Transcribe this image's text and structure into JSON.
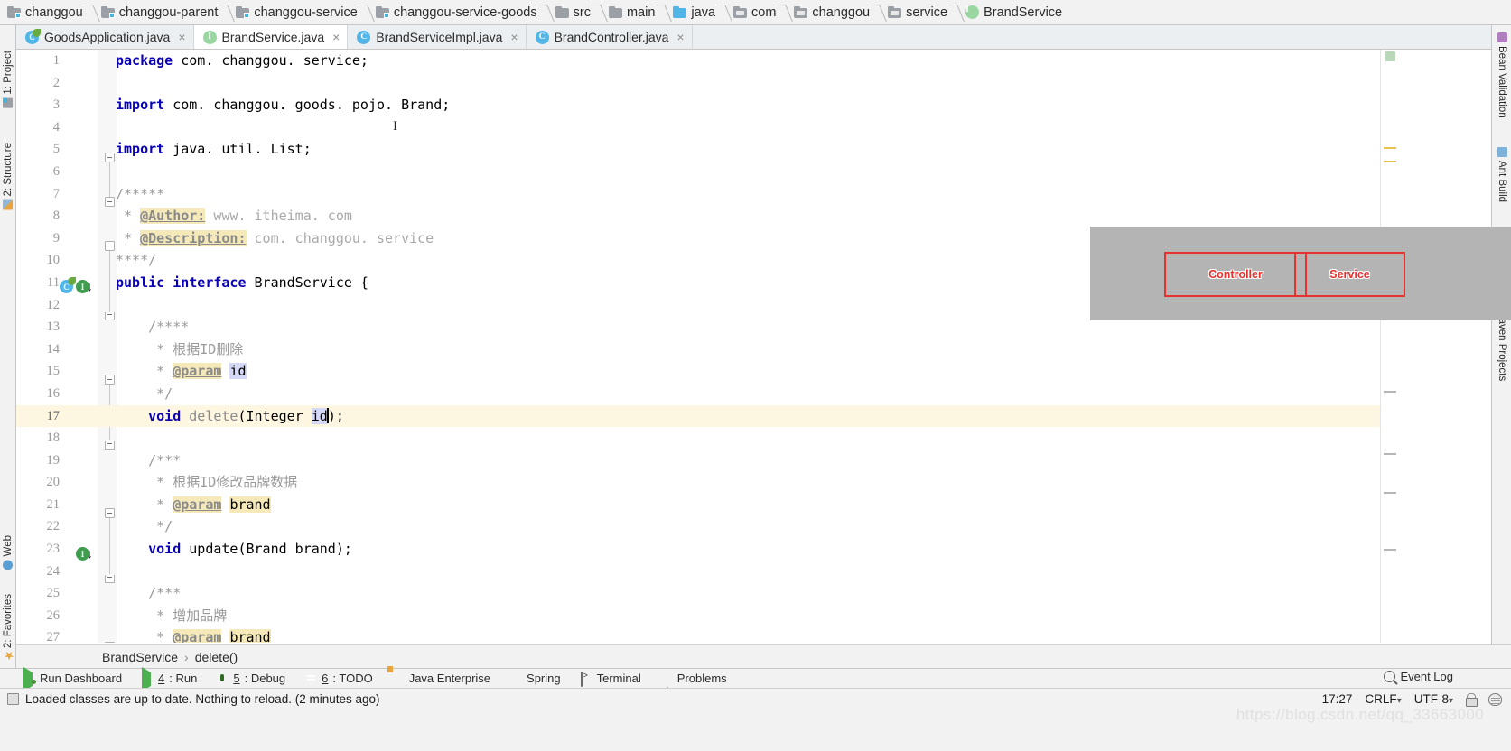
{
  "breadcrumb": {
    "items": [
      {
        "label": "changgou",
        "icon": "module-icon"
      },
      {
        "label": "changgou-parent",
        "icon": "module-icon"
      },
      {
        "label": "changgou-service",
        "icon": "module-icon"
      },
      {
        "label": "changgou-service-goods",
        "icon": "module-icon"
      },
      {
        "label": "src",
        "icon": "folder-icon"
      },
      {
        "label": "main",
        "icon": "folder-icon"
      },
      {
        "label": "java",
        "icon": "source-folder-icon"
      },
      {
        "label": "com",
        "icon": "package-icon"
      },
      {
        "label": "changgou",
        "icon": "package-icon"
      },
      {
        "label": "service",
        "icon": "package-icon"
      },
      {
        "label": "BrandService",
        "icon": "interface-icon"
      }
    ]
  },
  "tabs": [
    {
      "label": "GoodsApplication.java",
      "icon": "spring-boot-class-icon",
      "active": false,
      "close": "×"
    },
    {
      "label": "BrandService.java",
      "icon": "interface-icon",
      "active": true,
      "close": "×"
    },
    {
      "label": "BrandServiceImpl.java",
      "icon": "class-icon",
      "active": false,
      "close": "×"
    },
    {
      "label": "BrandController.java",
      "icon": "class-icon",
      "active": false,
      "close": "×"
    }
  ],
  "left_toolwindows": [
    {
      "label": "1: Project",
      "icon": "project-icon"
    },
    {
      "label": "2: Structure",
      "icon": "structure-icon"
    },
    {
      "label": "Web",
      "icon": "web-icon"
    },
    {
      "label": "2: Favorites",
      "icon": "favorites-star-icon"
    }
  ],
  "right_toolwindows": [
    {
      "label": "Bean Validation",
      "icon": "bean-validation-icon"
    },
    {
      "label": "Ant Build",
      "icon": "ant-build-icon"
    },
    {
      "label": "Maven Projects",
      "icon": "maven-icon"
    }
  ],
  "editor": {
    "language": "java",
    "caret_line": 17,
    "lines": [
      {
        "n": "1",
        "segments": [
          {
            "t": "package",
            "c": "kw"
          },
          {
            "t": " com. changgou. service;",
            "c": "plain"
          }
        ]
      },
      {
        "n": "2",
        "segments": []
      },
      {
        "n": "3",
        "segments": [
          {
            "t": "import",
            "c": "kw"
          },
          {
            "t": " com. changgou. goods. pojo. Brand;",
            "c": "plain"
          }
        ]
      },
      {
        "n": "4",
        "segments": []
      },
      {
        "n": "5",
        "segments": [
          {
            "t": "import",
            "c": "kw"
          },
          {
            "t": " java. util. List;",
            "c": "plain"
          }
        ]
      },
      {
        "n": "6",
        "segments": []
      },
      {
        "n": "7",
        "segments": [
          {
            "t": "/*****",
            "c": "cm"
          }
        ]
      },
      {
        "n": "8",
        "segments": [
          {
            "t": " * ",
            "c": "cm"
          },
          {
            "t": "@Author:",
            "c": "tag"
          },
          {
            "t": " www. itheima. com",
            "c": "tagv"
          }
        ]
      },
      {
        "n": "9",
        "segments": [
          {
            "t": " * ",
            "c": "cm"
          },
          {
            "t": "@Description:",
            "c": "tag"
          },
          {
            "t": " com. changgou. service",
            "c": "tagv"
          }
        ]
      },
      {
        "n": "10",
        "segments": [
          {
            "t": "****/",
            "c": "cm"
          }
        ]
      },
      {
        "n": "11",
        "segments": [
          {
            "t": "public interface",
            "c": "kw"
          },
          {
            "t": " BrandService {",
            "c": "plain"
          }
        ]
      },
      {
        "n": "12",
        "segments": []
      },
      {
        "n": "13",
        "segments": [
          {
            "t": "    /****",
            "c": "cm"
          }
        ]
      },
      {
        "n": "14",
        "segments": [
          {
            "t": "     * 根据ID删除",
            "c": "cm"
          }
        ]
      },
      {
        "n": "15",
        "segments": [
          {
            "t": "     * ",
            "c": "cm"
          },
          {
            "t": "@param",
            "c": "tag"
          },
          {
            "t": " ",
            "c": "cm"
          },
          {
            "t": "id",
            "c": "sel"
          }
        ]
      },
      {
        "n": "16",
        "segments": [
          {
            "t": "     */",
            "c": "cm"
          }
        ]
      },
      {
        "n": "17",
        "segments": [
          {
            "t": "    void",
            "c": "kw"
          },
          {
            "t": " ",
            "c": "plain"
          },
          {
            "t": "delete",
            "c": "mname"
          },
          {
            "t": "(Integer ",
            "c": "plain"
          },
          {
            "t": "id",
            "c": "sel"
          },
          {
            "t": ");",
            "c": "plain"
          }
        ]
      },
      {
        "n": "18",
        "segments": []
      },
      {
        "n": "19",
        "segments": [
          {
            "t": "    /***",
            "c": "cm"
          }
        ]
      },
      {
        "n": "20",
        "segments": [
          {
            "t": "     * 根据ID修改品牌数据",
            "c": "cm"
          }
        ]
      },
      {
        "n": "21",
        "segments": [
          {
            "t": "     * ",
            "c": "cm"
          },
          {
            "t": "@param",
            "c": "tag"
          },
          {
            "t": " ",
            "c": "cm"
          },
          {
            "t": "brand",
            "c": "hl"
          }
        ]
      },
      {
        "n": "22",
        "segments": [
          {
            "t": "     */",
            "c": "cm"
          }
        ]
      },
      {
        "n": "23",
        "segments": [
          {
            "t": "    void",
            "c": "kw"
          },
          {
            "t": " update(Brand brand);",
            "c": "plain"
          }
        ]
      },
      {
        "n": "24",
        "segments": []
      },
      {
        "n": "25",
        "segments": [
          {
            "t": "    /***",
            "c": "cm"
          }
        ]
      },
      {
        "n": "26",
        "segments": [
          {
            "t": "     * 增加品牌",
            "c": "cm"
          }
        ]
      },
      {
        "n": "27",
        "segments": [
          {
            "t": "     * ",
            "c": "cm"
          },
          {
            "t": "@param",
            "c": "tag"
          },
          {
            "t": " ",
            "c": "cm"
          },
          {
            "t": "brand",
            "c": "hl"
          }
        ]
      }
    ]
  },
  "overlay": {
    "boxes": [
      {
        "label": "Controller"
      },
      {
        "label": "Service"
      }
    ],
    "border_color": "#e8302d",
    "background_color": "#b4b4b4"
  },
  "structure_bar": {
    "class": "BrandService",
    "separator": "›",
    "member": "delete()"
  },
  "bottom_toolwindows": [
    {
      "label": "Run Dashboard",
      "mnemonic": "",
      "icon": "run-dashboard-icon"
    },
    {
      "label": ": Run",
      "mnemonic": "4",
      "icon": "run-icon"
    },
    {
      "label": ": Debug",
      "mnemonic": "5",
      "icon": "debug-icon"
    },
    {
      "label": ": TODO",
      "mnemonic": "6",
      "icon": "todo-icon"
    },
    {
      "label": "Java Enterprise",
      "mnemonic": "",
      "icon": "java-enterprise-icon"
    },
    {
      "label": "Spring",
      "mnemonic": "",
      "icon": "spring-icon"
    },
    {
      "label": "Terminal",
      "mnemonic": "",
      "icon": "terminal-icon"
    },
    {
      "label": "Problems",
      "mnemonic": "",
      "icon": "problems-icon"
    }
  ],
  "event_log": {
    "label": "Event Log",
    "icon": "magnifier-icon"
  },
  "statusbar": {
    "message": "Loaded classes are up to date. Nothing to reload. (2 minutes ago)",
    "time": "17:27",
    "line_separator": "CRLF",
    "encoding": "UTF-8",
    "lock_icon": "lock-icon",
    "inspection_icon": "inspection-icon",
    "watermark": "https://blog.csdn.net/qq_33663000"
  }
}
